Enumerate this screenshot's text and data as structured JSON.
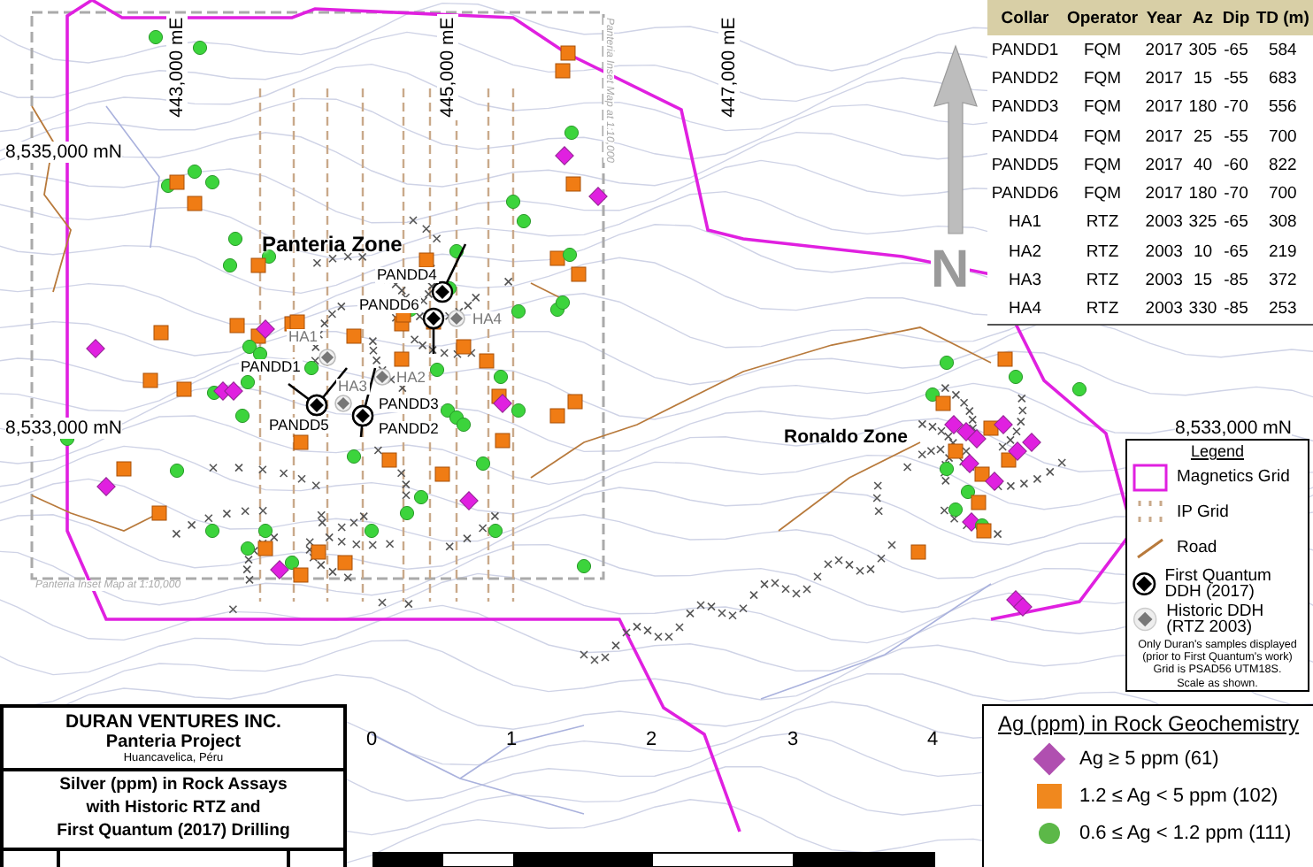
{
  "map": {
    "easting_labels": [
      "443,000 mE",
      "445,000 mE",
      "447,000 mE"
    ],
    "northing_labels": [
      "8,535,000 mN",
      "8,533,000 mN",
      "8,533,000 mN"
    ],
    "zones": [
      "Panteria Zone",
      "Ronaldo Zone"
    ],
    "drill_holes": [
      {
        "label": "PANDD4",
        "kind": "fqm"
      },
      {
        "label": "PANDD6",
        "kind": "fqm"
      },
      {
        "label": "HA4",
        "kind": "rtz"
      },
      {
        "label": "HA1",
        "kind": "rtz"
      },
      {
        "label": "PANDD1",
        "kind": "fqm"
      },
      {
        "label": "HA2",
        "kind": "rtz"
      },
      {
        "label": "HA3",
        "kind": "rtz"
      },
      {
        "label": "PANDD3",
        "kind": "fqm"
      },
      {
        "label": "PANDD5",
        "kind": "fqm"
      },
      {
        "label": "PANDD2",
        "kind": "fqm"
      }
    ],
    "inset_notes": [
      "Panteria Inset Map at 1:10,000",
      "Panteria Inset Map at 1:10,000"
    ],
    "north_label": "N"
  },
  "drill_table": {
    "columns": [
      "Collar",
      "Operator",
      "Year",
      "Az",
      "Dip",
      "TD (m)"
    ],
    "rows": [
      [
        "PANDD1",
        "FQM",
        "2017",
        "305",
        "-65",
        "584"
      ],
      [
        "PANDD2",
        "FQM",
        "2017",
        "15",
        "-55",
        "683"
      ],
      [
        "PANDD3",
        "FQM",
        "2017",
        "180",
        "-70",
        "556"
      ],
      [
        "PANDD4",
        "FQM",
        "2017",
        "25",
        "-55",
        "700"
      ],
      [
        "PANDD5",
        "FQM",
        "2017",
        "40",
        "-60",
        "822"
      ],
      [
        "PANDD6",
        "FQM",
        "2017",
        "180",
        "-70",
        "700"
      ],
      [
        "HA1",
        "RTZ",
        "2003",
        "325",
        "-65",
        "308"
      ],
      [
        "HA2",
        "RTZ",
        "2003",
        "10",
        "-65",
        "219"
      ],
      [
        "HA3",
        "RTZ",
        "2003",
        "15",
        "-85",
        "372"
      ],
      [
        "HA4",
        "RTZ",
        "2003",
        "330",
        "-85",
        "253"
      ]
    ]
  },
  "legend": {
    "title": "Legend",
    "items": [
      {
        "kind": "magnetics",
        "label": "Magnetics Grid"
      },
      {
        "kind": "ip",
        "label": "IP Grid"
      },
      {
        "kind": "road",
        "label": "Road"
      },
      {
        "kind": "fqm",
        "label": "First Quantum DDH (2017)"
      },
      {
        "kind": "rtz",
        "label": "Historic DDH (RTZ 2003)"
      }
    ],
    "note": [
      "Only Duran's samples displayed",
      "(prior to First Quantum's work)",
      "Grid is PSAD56 UTM18S.",
      "Scale as shown."
    ]
  },
  "title_block": {
    "company": "DURAN VENTURES INC.",
    "project": "Panteria Project",
    "location": "Huancavelica, Péru",
    "map_title": [
      "Silver (ppm) in Rock Assays",
      "with Historic RTZ and",
      "First Quantum (2017) Drilling"
    ]
  },
  "ag_legend": {
    "title": "Ag (ppm) in Rock Geochemistry",
    "items": [
      {
        "kind": "diamond",
        "color": "#b04fb0",
        "label": "Ag ≥ 5 ppm (61)"
      },
      {
        "kind": "square",
        "color": "#f0881e",
        "label": "1.2 ≤ Ag < 5 ppm (102)"
      },
      {
        "kind": "circle",
        "color": "#5cb848",
        "label": "0.6 ≤ Ag < 1.2 ppm (111)"
      }
    ]
  },
  "scale_bar": {
    "ticks": [
      "0",
      "1",
      "2",
      "3",
      "4"
    ]
  }
}
